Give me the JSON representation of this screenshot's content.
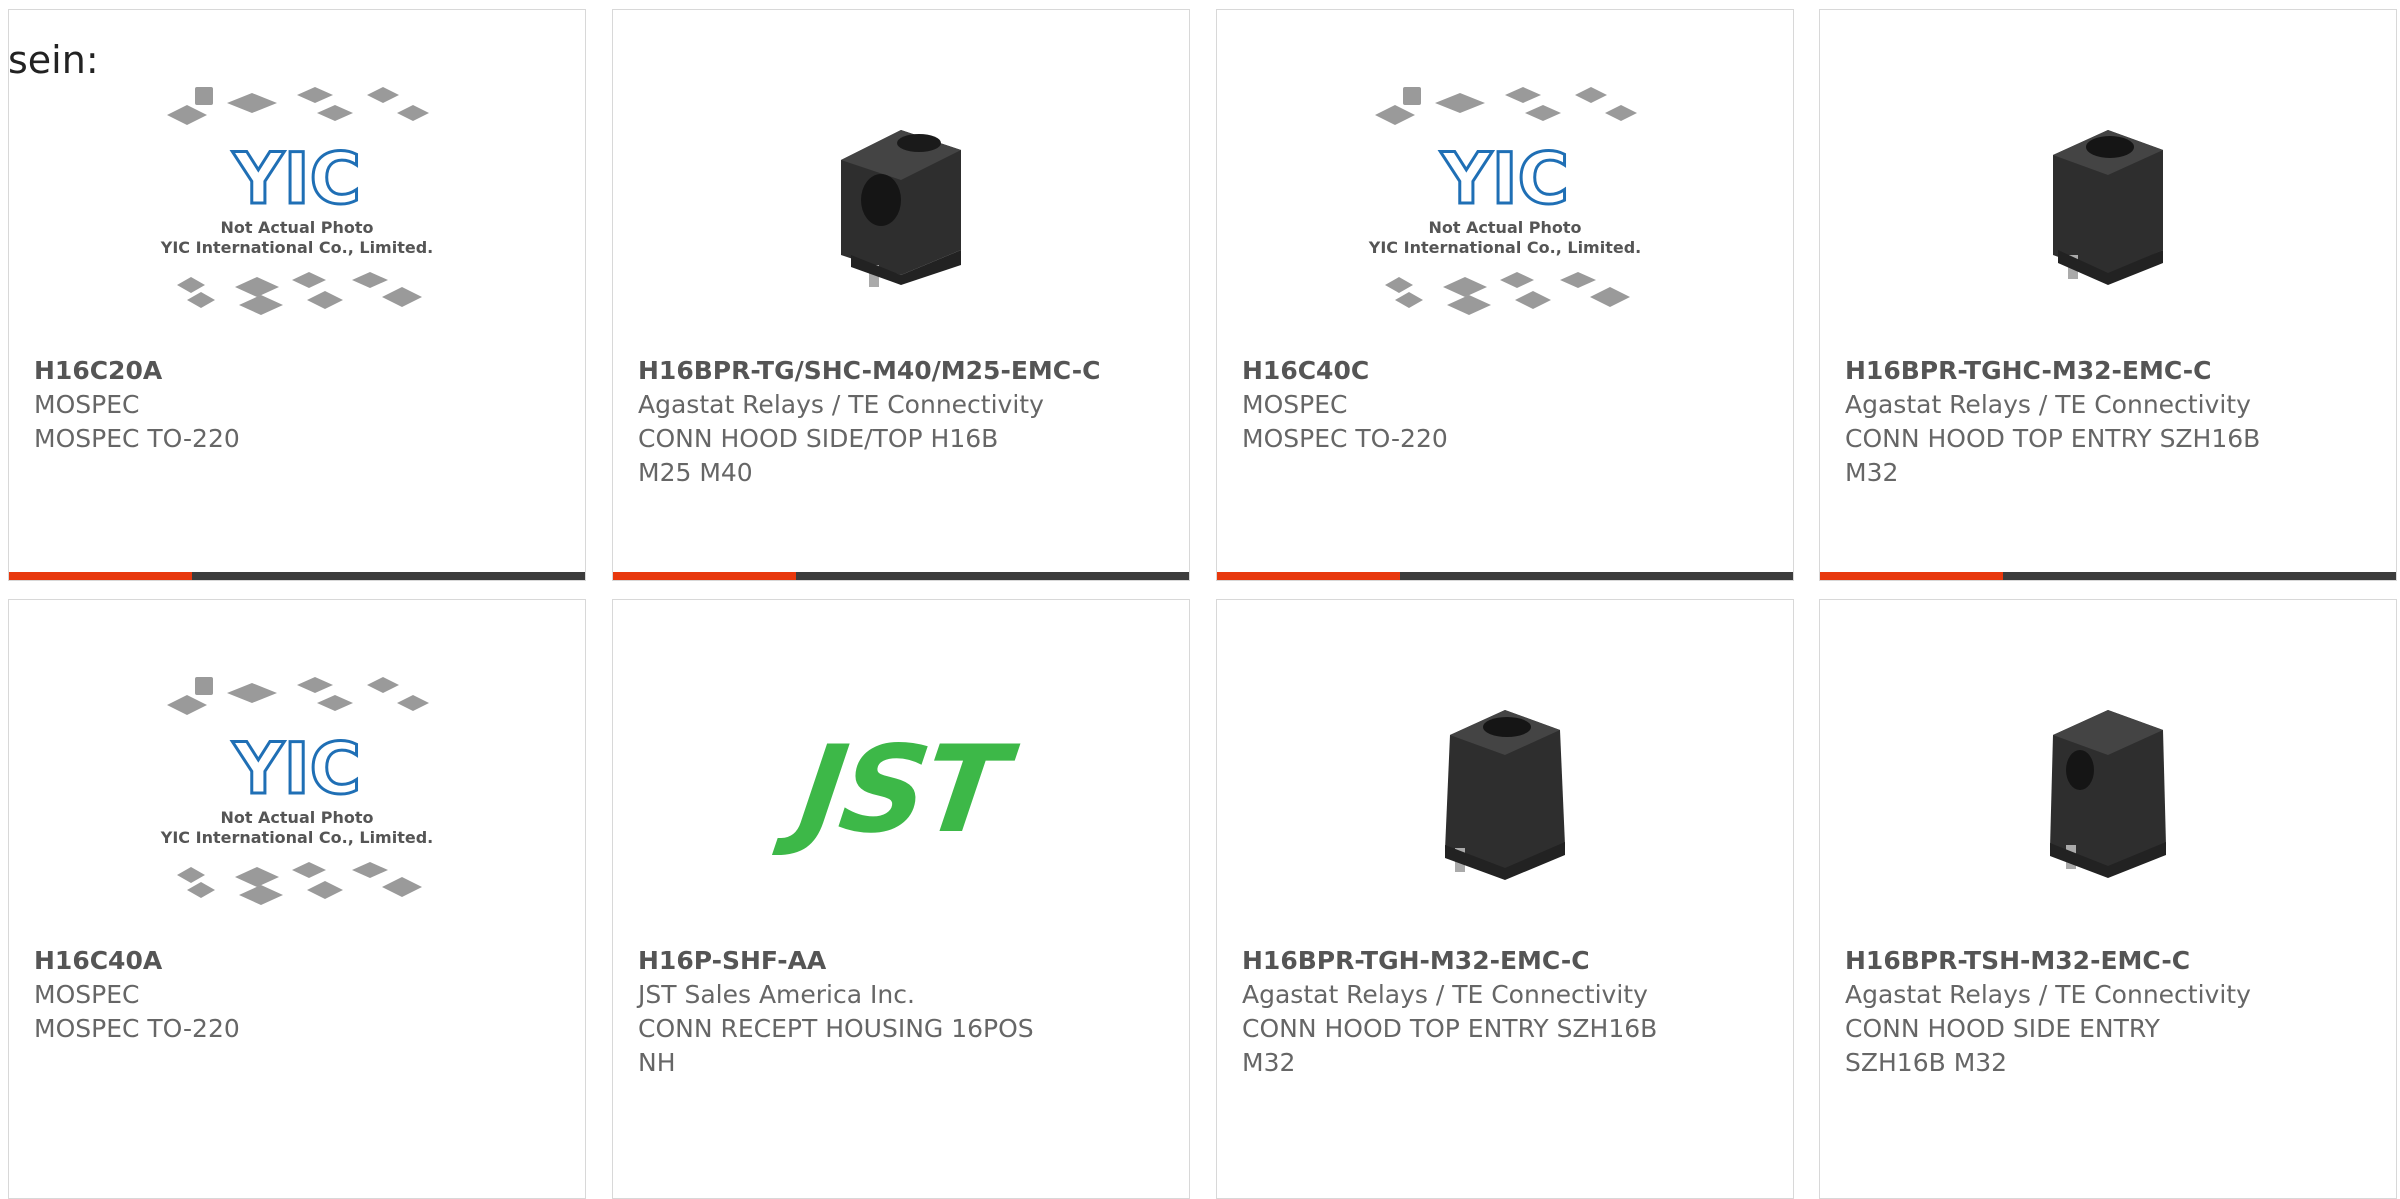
{
  "page": {
    "prefix_text": "sein:"
  },
  "colors": {
    "accent": "#e8380d",
    "bar": "#3c3c3c",
    "jst_green": "#3db848",
    "yic_blue": "#1f6fb5"
  },
  "placeholder": {
    "line1": "Not Actual Photo",
    "line2": "YIC International Co., Limited.",
    "logo": "YIC"
  },
  "products": [
    {
      "part": "H16C20A",
      "manufacturer": "MOSPEC",
      "desc1": "MOSPEC TO-220",
      "desc2": "",
      "image": "yic-placeholder"
    },
    {
      "part": "H16BPR-TG/SHC-M40/M25-EMC-C",
      "manufacturer": "Agastat Relays / TE Connectivity",
      "desc1": "CONN HOOD SIDE/TOP H16B",
      "desc2": "M25 M40",
      "image": "connector-hood-side"
    },
    {
      "part": "H16C40C",
      "manufacturer": "MOSPEC",
      "desc1": "MOSPEC TO-220",
      "desc2": "",
      "image": "yic-placeholder"
    },
    {
      "part": "H16BPR-TGHC-M32-EMC-C",
      "manufacturer": "Agastat Relays / TE Connectivity",
      "desc1": "CONN HOOD TOP ENTRY SZH16B",
      "desc2": "M32",
      "image": "connector-hood-top"
    },
    {
      "part": "H16C40A",
      "manufacturer": "MOSPEC",
      "desc1": "MOSPEC TO-220",
      "desc2": "",
      "image": "yic-placeholder"
    },
    {
      "part": "H16P-SHF-AA",
      "manufacturer": "JST Sales America Inc.",
      "desc1": "CONN RECEPT HOUSING 16POS",
      "desc2": "NH",
      "image": "jst-logo",
      "logo_text": "JST"
    },
    {
      "part": "H16BPR-TGH-M32-EMC-C",
      "manufacturer": "Agastat Relays / TE Connectivity",
      "desc1": "CONN HOOD TOP ENTRY SZH16B",
      "desc2": "M32",
      "image": "connector-hood-top-tall"
    },
    {
      "part": "H16BPR-TSH-M32-EMC-C",
      "manufacturer": "Agastat Relays / TE Connectivity",
      "desc1": "CONN HOOD SIDE ENTRY",
      "desc2": "SZH16B M32",
      "image": "connector-hood-side-tall"
    }
  ]
}
